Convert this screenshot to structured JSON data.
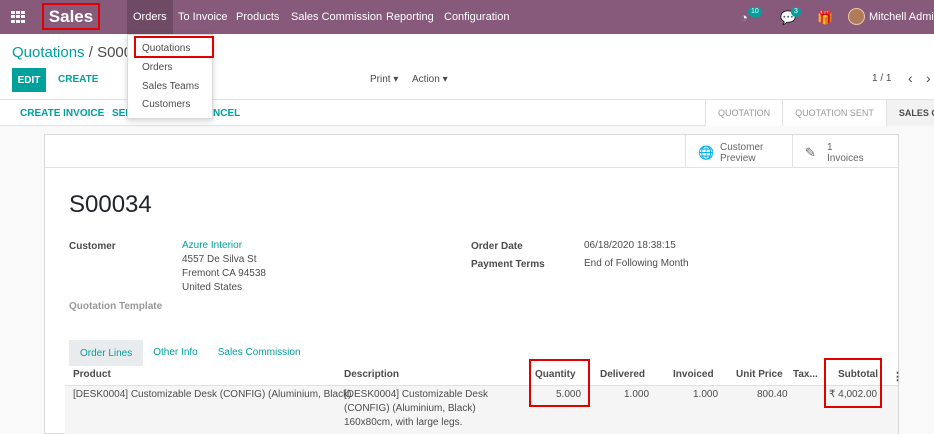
{
  "navbar": {
    "app_name": "Sales",
    "menu": [
      "Orders",
      "To Invoice",
      "Products",
      "Sales Commission",
      "Reporting",
      "Configuration"
    ],
    "activity_count": "10",
    "message_count": "3",
    "user_name": "Mitchell Admin"
  },
  "dropdown": {
    "items": [
      "Quotations",
      "Orders",
      "Sales Teams",
      "Customers"
    ]
  },
  "control": {
    "breadcrumb_parent": "Quotations",
    "breadcrumb_sep": "/",
    "breadcrumb_current": "S0003",
    "edit_label": "EDIT",
    "create_label": "CREATE",
    "print_label": "Print",
    "action_label": "Action",
    "pager": "1 / 1"
  },
  "statusbar": {
    "create_invoice": "CREATE INVOICE",
    "send_partial": "SEN",
    "cancel_partial": "NCEL",
    "stages": [
      "QUOTATION",
      "QUOTATION SENT",
      "SALES ORDER"
    ],
    "active_stage": "SALES ORDER"
  },
  "sheet": {
    "customer_preview_line1": "Customer",
    "customer_preview_line2": "Preview",
    "invoices_count": "1",
    "invoices_label": "Invoices",
    "order_name": "S00034",
    "customer_label": "Customer",
    "customer_name": "Azure Interior",
    "address_lines": [
      "4557 De Silva St",
      "Fremont CA 94538",
      "United States"
    ],
    "order_date_label": "Order Date",
    "order_date": "06/18/2020 18:38:15",
    "payment_terms_label": "Payment Terms",
    "payment_terms": "End of Following Month",
    "quotation_template_label": "Quotation Template",
    "tabs": [
      "Order Lines",
      "Other Info",
      "Sales Commission"
    ]
  },
  "table": {
    "headers": [
      "Product",
      "Description",
      "Quantity",
      "Delivered",
      "Invoiced",
      "Unit Price",
      "Tax...",
      "Subtotal"
    ],
    "rows": [
      {
        "product": "[DESK0004] Customizable Desk (CONFIG) (Aluminium, Black)",
        "description": [
          "[DESK0004] Customizable Desk",
          "(CONFIG) (Aluminium, Black)",
          "160x80cm, with large legs."
        ],
        "quantity": "5.000",
        "delivered": "1.000",
        "invoiced": "1.000",
        "unit_price": "800.40",
        "subtotal": "₹ 4,002.00"
      }
    ]
  },
  "icons": {
    "apps": "grid-icon",
    "activity": "clock-icon",
    "messages": "chat-icon",
    "gift": "gift-icon",
    "globe": "globe-icon",
    "invoice": "pencil-square-icon"
  },
  "colors": {
    "navbar": "#875a7b",
    "accent": "#00a09d",
    "highlight": "#e00000"
  }
}
